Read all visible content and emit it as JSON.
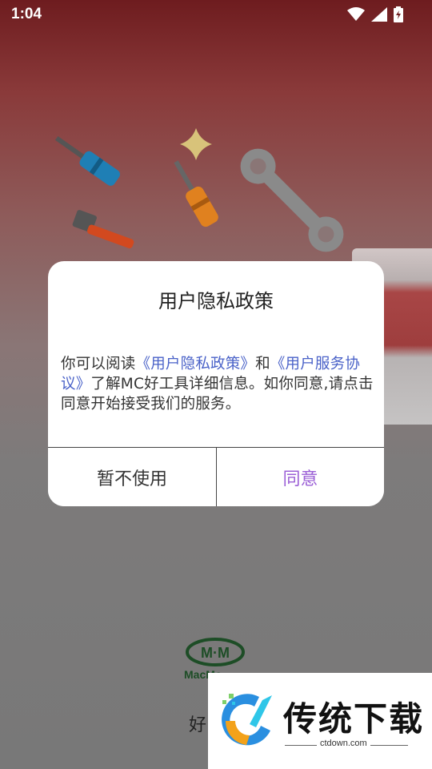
{
  "status_bar": {
    "time": "1:04",
    "icons": [
      "wifi-icon",
      "signal-icon",
      "battery-charging-icon"
    ]
  },
  "dialog": {
    "title": "用户隐私政策",
    "body_prefix": "你可以阅读",
    "privacy_link": "《用户隐私政策》",
    "body_and": "和",
    "service_link": "《用户服务协议》",
    "body_suffix": "了解MC好工具详细信息。如你同意,请点击同意开始接受我们的服务。",
    "decline_label": "暂不使用",
    "agree_label": "同意"
  },
  "brand": {
    "logo_text": "M·M",
    "sub_text": "MacMo",
    "app_name_partial": "好"
  },
  "watermark": {
    "text": "传统下载",
    "url": "ctdown.com"
  },
  "colors": {
    "link": "#4a62c8",
    "agree": "#9b5fd6",
    "brand_green": "#1d4d26"
  }
}
